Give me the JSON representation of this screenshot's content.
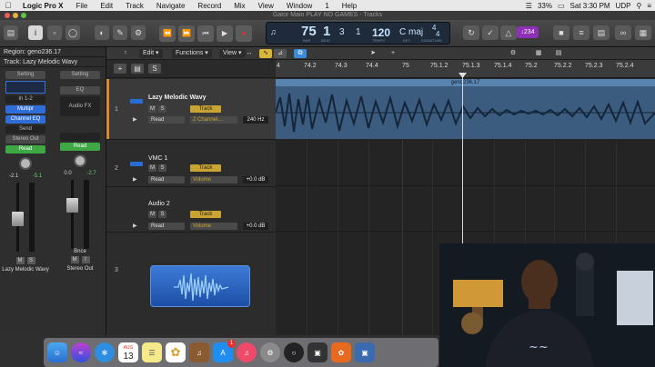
{
  "menubar": {
    "app": "Logic Pro X",
    "items": [
      "File",
      "Edit",
      "Track",
      "Navigate",
      "Record",
      "Mix",
      "View",
      "Window",
      "1",
      "Help"
    ],
    "battery": "33%",
    "clock": "Sat 3:30 PM",
    "extra": "UDP"
  },
  "window": {
    "title": "Gator Main PLAY NO GAMES - Tracks"
  },
  "lcd": {
    "bar": "75",
    "beat": "1",
    "div": "3",
    "tick": "1",
    "bar_label": "BAR",
    "beat_label": "BEAT",
    "tempo": "120",
    "tempo_label": "TEMPO",
    "key": "C maj",
    "key_label": "KEY",
    "sig_top": "4",
    "sig_bottom": "4",
    "sig_label": "SIGNATURE"
  },
  "control_badge": "↓234",
  "inspector": {
    "region": "Region: geno236.17",
    "track": "Track: Lazy Melodic Wavy",
    "strip1": {
      "setting": "Setting",
      "input": "In 1-2",
      "plugin1": "Multipr",
      "plugin2": "Channel EQ",
      "send": "Send",
      "output": "Stereo Out",
      "mode": "Read",
      "val_left": "-2.1",
      "val_right": "-5.1",
      "name": "Lazy Melodic Wavy"
    },
    "strip2": {
      "setting": "Setting",
      "eq": "EQ",
      "audiofx": "Audio FX",
      "mode": "Read",
      "val_left": "0.0",
      "val_right": "-2.7",
      "bnce": "Bnce",
      "name": "Stereo Out"
    },
    "m": "M",
    "s": "S",
    "i": "I"
  },
  "tracktool": {
    "edit": "Edit",
    "functions": "Functions",
    "view": "View"
  },
  "tracks": [
    {
      "num": "1",
      "name": "Lazy Melodic Wavy",
      "mode": "Read",
      "param": "2 Channel...",
      "value": "240 Hz",
      "track_btn": "Track"
    },
    {
      "num": "2",
      "name": "VMC 1",
      "mode": "Read",
      "param": "Volume",
      "value": "+0.0 dB",
      "track_btn": "Track"
    },
    {
      "num": "",
      "name": "Audio 2",
      "mode": "Read",
      "param": "Volume",
      "value": "+0.0 dB",
      "track_btn": "Track"
    },
    {
      "num": "3",
      "name": "",
      "mode": "",
      "param": "",
      "value": "",
      "track_btn": ""
    }
  ],
  "ruler": [
    "4",
    "74.2",
    "74.3",
    "74.4",
    "75",
    "75.1.2",
    "75.1.3",
    "75.1.4",
    "75.2",
    "75.2.2",
    "75.2.3",
    "75.2.4"
  ],
  "region": {
    "name": "geno236.17"
  },
  "dock": {
    "calendar_month": "AUG",
    "calendar_day": "13",
    "appstore_badge": "1"
  }
}
